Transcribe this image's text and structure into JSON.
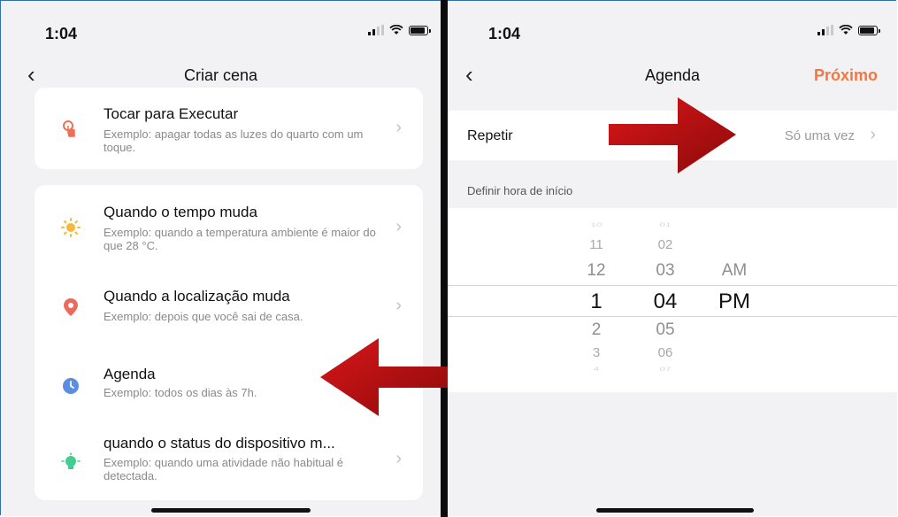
{
  "left": {
    "status_time": "1:04",
    "back_icon": "‹",
    "title": "Criar cena",
    "chevron": "›",
    "card1": [
      {
        "icon": "tap-icon",
        "title": "Tocar para Executar",
        "subtitle": "Exemplo: apagar todas as luzes do quarto com um toque."
      }
    ],
    "card2": [
      {
        "icon": "sun-icon",
        "title": "Quando o tempo muda",
        "subtitle": "Exemplo: quando a temperatura ambiente é maior do que 28 °C."
      },
      {
        "icon": "location-pin-icon",
        "title": "Quando a localização muda",
        "subtitle": "Exemplo: depois que você sai de casa."
      },
      {
        "icon": "clock-icon",
        "title": "Agenda",
        "subtitle": "Exemplo: todos os dias às 7h."
      },
      {
        "icon": "device-icon",
        "title": "quando o status do dispositivo m...",
        "subtitle": "Exemplo: quando uma atividade não habitual é detectada."
      }
    ]
  },
  "right": {
    "status_time": "1:04",
    "back_icon": "‹",
    "title": "Agenda",
    "next_label": "Próximo",
    "repeat_label": "Repetir",
    "repeat_value": "Só uma vez",
    "repeat_chevron": "›",
    "section_label": "Definir hora de início",
    "picker": {
      "hours": [
        "10",
        "11",
        "12",
        "1",
        "2",
        "3",
        "4"
      ],
      "minutes": [
        "01",
        "02",
        "03",
        "04",
        "05",
        "06",
        "07"
      ],
      "ampm_above": "AM",
      "ampm_selected": "PM",
      "selected_hour": "1",
      "selected_minute": "04",
      "selected_ampm": "PM"
    }
  },
  "colors": {
    "accent_orange": "#f07840",
    "arrow_red": "#c40d0d",
    "tap_icon": "#ee6f55",
    "sun_icon": "#f5b83a",
    "location_icon": "#ec6a5c",
    "clock_icon": "#5b8de0",
    "device_icon": "#3fcf8e"
  }
}
